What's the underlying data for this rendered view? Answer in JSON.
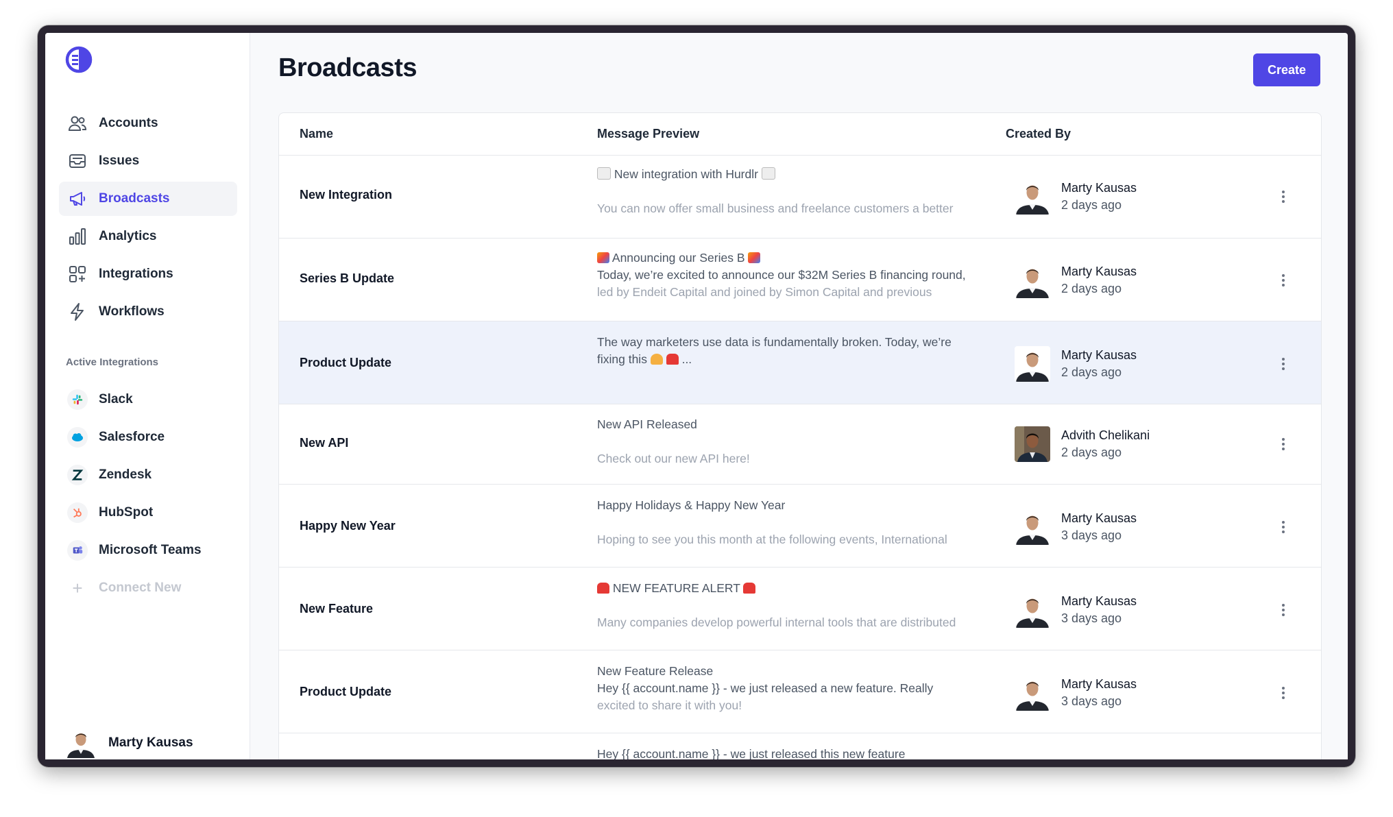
{
  "app": {
    "title": "Broadcasts",
    "create_label": "Create"
  },
  "sidebar": {
    "nav": [
      {
        "label": "Accounts",
        "icon": "users-icon"
      },
      {
        "label": "Issues",
        "icon": "inbox-icon"
      },
      {
        "label": "Broadcasts",
        "icon": "megaphone-icon",
        "active": true
      },
      {
        "label": "Analytics",
        "icon": "bar-chart-icon"
      },
      {
        "label": "Integrations",
        "icon": "grid-plus-icon"
      },
      {
        "label": "Workflows",
        "icon": "lightning-icon"
      }
    ],
    "section_label": "Active Integrations",
    "integrations": [
      {
        "label": "Slack",
        "icon": "slack-icon"
      },
      {
        "label": "Salesforce",
        "icon": "salesforce-icon"
      },
      {
        "label": "Zendesk",
        "icon": "zendesk-icon"
      },
      {
        "label": "HubSpot",
        "icon": "hubspot-icon"
      },
      {
        "label": "Microsoft Teams",
        "icon": "teams-icon"
      },
      {
        "label": "Connect New",
        "icon": "plus-icon"
      }
    ],
    "user": {
      "name": "Marty Kausas"
    }
  },
  "table": {
    "headers": {
      "name": "Name",
      "message": "Message Preview",
      "created_by": "Created By"
    },
    "rows": [
      {
        "name": "New Integration",
        "line1": "New integration with Hurdlr",
        "line2": "",
        "line3": "You can now offer small business and freelance customers a better",
        "author": "Marty Kausas",
        "time": "2 days ago"
      },
      {
        "name": "Series B Update",
        "line1": "Announcing our Series B",
        "line2": "Today, we’re excited to announce our $32M Series B financing round,",
        "line3": "led by Endeit Capital and joined by Simon Capital and previous",
        "author": "Marty Kausas",
        "time": "2 days ago"
      },
      {
        "name": "Product Update",
        "line1": "The way marketers use data is fundamentally broken. Today, we’re",
        "line2": "fixing this",
        "line3": "",
        "author": "Marty Kausas",
        "time": "2 days ago"
      },
      {
        "name": "New API",
        "line1": "New API Released",
        "line2": "",
        "line3": "Check out our new API here!",
        "author": "Advith Chelikani",
        "time": "2 days ago"
      },
      {
        "name": "Happy New Year",
        "line1": "Happy Holidays & Happy New Year",
        "line2": "",
        "line3": "Hoping to see you this month at the following events, International",
        "author": "Marty Kausas",
        "time": "3 days ago"
      },
      {
        "name": "New Feature",
        "line1": "NEW FEATURE ALERT",
        "line2": "",
        "line3": "Many companies develop powerful internal tools that are distributed",
        "author": "Marty Kausas",
        "time": "3 days ago"
      },
      {
        "name": "Product Update",
        "line1": "New Feature Release",
        "line2": "Hey {{ account.name }} - we just released a new feature. Really",
        "line3": "excited to share it with you!",
        "author": "Marty Kausas",
        "time": "3 days ago"
      },
      {
        "name": "",
        "line1": "Hey {{ account.name }} - we just released this new feature",
        "line2": "",
        "line3": "",
        "author": "",
        "time": ""
      }
    ]
  },
  "ellipsis": "...",
  "colors": {
    "accent": "#4f46e5",
    "highlight": "#eef2fb"
  }
}
